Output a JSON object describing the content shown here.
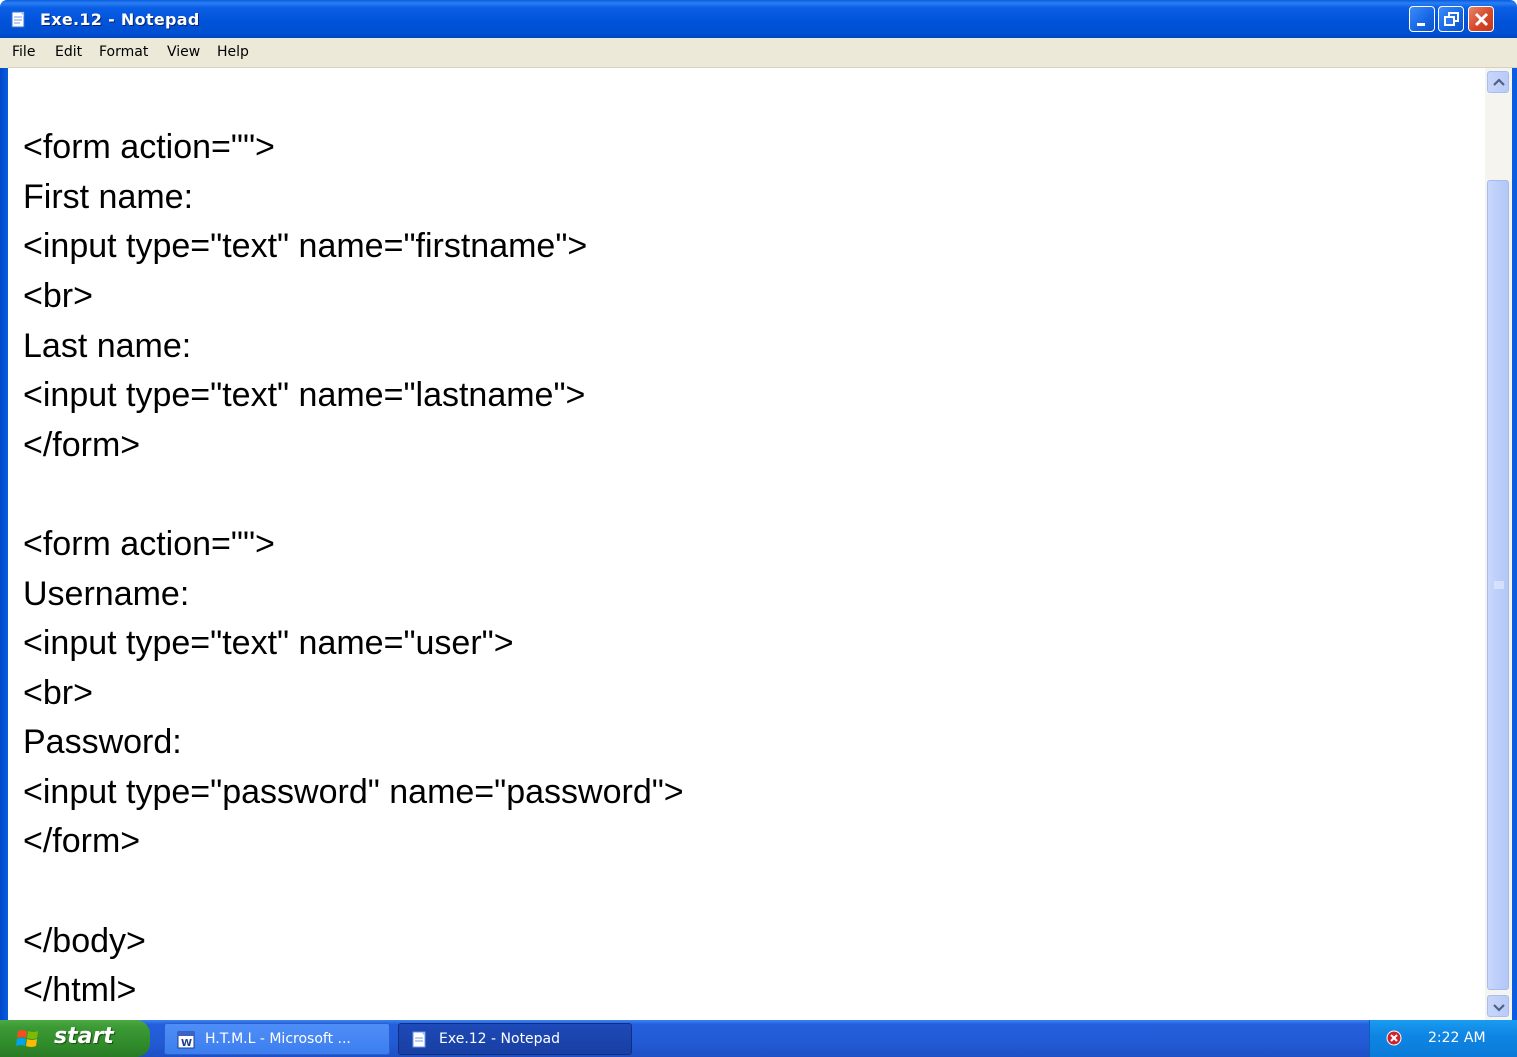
{
  "window": {
    "title": "Exe.12 - Notepad",
    "buttons": [
      "minimize",
      "maximize",
      "close"
    ]
  },
  "menu": {
    "items": [
      "File",
      "Edit",
      "Format",
      "View",
      "Help"
    ]
  },
  "editor": {
    "lines": [
      "",
      "<form action=\"\">",
      "First name:",
      "<input type=\"text\" name=\"firstname\">",
      "<br>",
      "Last name:",
      "<input type=\"text\" name=\"lastname\">",
      "</form>",
      "",
      "<form action=\"\">",
      "Username:",
      "<input type=\"text\" name=\"user\">",
      "<br>",
      "Password:",
      "<input type=\"password\" name=\"password\">",
      "</form>",
      "",
      "</body>",
      "</html>"
    ]
  },
  "scrollbar": {
    "up_icon": "arrow-up-icon",
    "down_icon": "arrow-down-icon"
  },
  "taskbar": {
    "start_label": "start",
    "tasks": [
      {
        "label": "H.T.M.L - Microsoft ...",
        "icon": "word-document-icon"
      },
      {
        "label": "Exe.12 - Notepad",
        "icon": "notepad-icon"
      }
    ],
    "tray_icon": "security-alert-icon",
    "clock": "2:22 AM"
  },
  "colors": {
    "titlebar": "#0a5fe6",
    "menubar": "#ece9d8",
    "taskbar": "#245fdc",
    "start_button": "#3c9a35",
    "tray": "#0f86e4"
  }
}
